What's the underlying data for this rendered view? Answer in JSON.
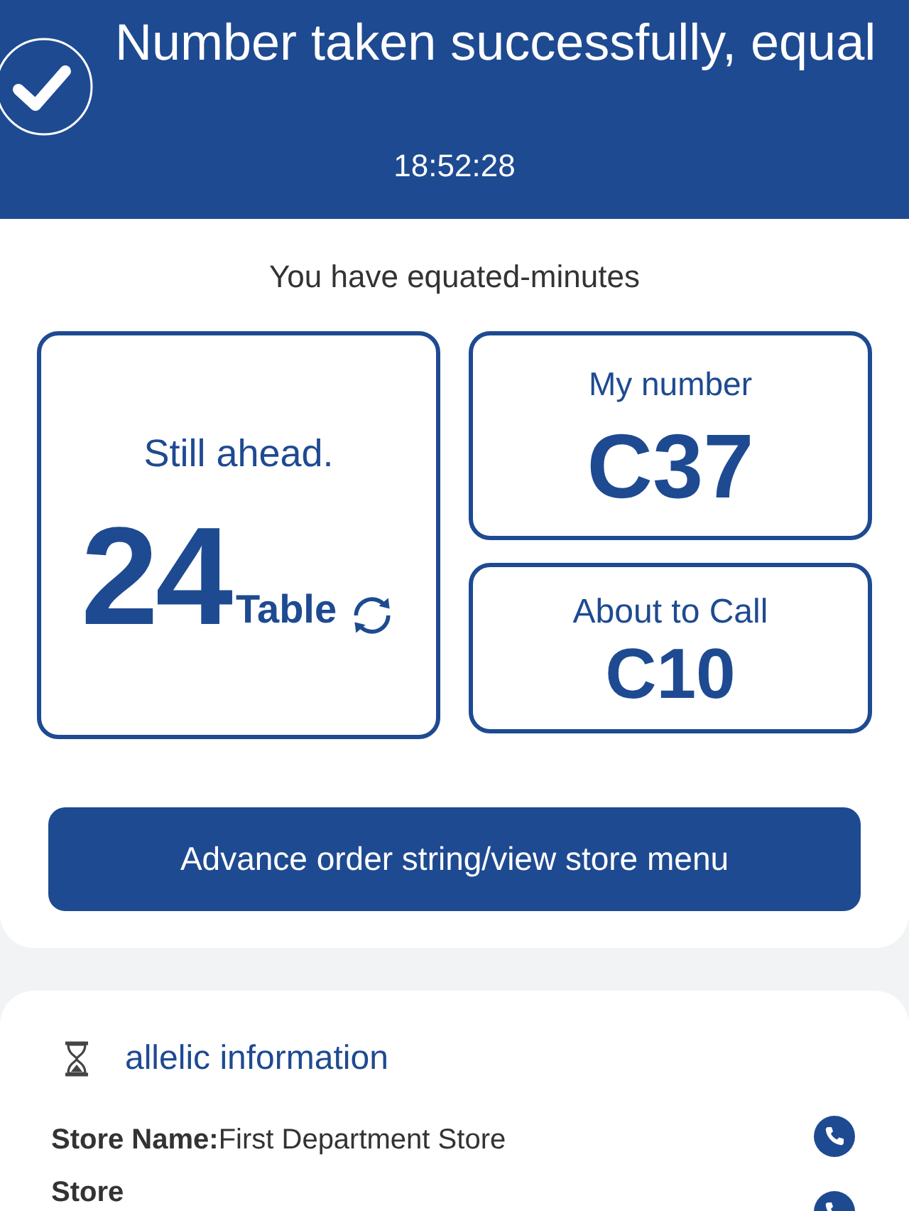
{
  "header": {
    "title": "Number taken successfully, equal",
    "time": "18:52:28"
  },
  "status": {
    "message": "You have equated-minutes",
    "ahead": {
      "label": "Still ahead.",
      "count": "24",
      "unit": "Table"
    },
    "my_number": {
      "label": "My number",
      "value": "C37"
    },
    "about_to_call": {
      "label": "About to Call",
      "value": "C10"
    },
    "button": "Advance order string/view store menu"
  },
  "info": {
    "title": "allelic information",
    "rows": [
      {
        "label": "Store Name:",
        "value": "First Department Store"
      },
      {
        "label": "Store"
      }
    ]
  }
}
